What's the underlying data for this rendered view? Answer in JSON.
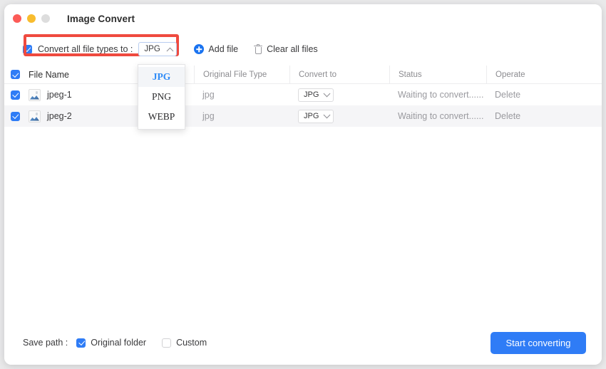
{
  "window": {
    "title": "Image Convert",
    "traffic_lights": [
      "close",
      "minimize",
      "zoom"
    ]
  },
  "toolbar": {
    "convert_all_label": "Convert all file types to :",
    "convert_all_checked": true,
    "selected_type": "JPG",
    "add_file_label": "Add file",
    "clear_all_label": "Clear all files",
    "add_file_icon": "plus-circle-icon",
    "clear_all_icon": "trash-icon",
    "annotation_color": "#ef4a3f"
  },
  "type_menu": {
    "open": true,
    "selected": "JPG",
    "options": [
      "JPG",
      "PNG",
      "WEBP"
    ]
  },
  "table": {
    "select_all_checked": true,
    "headers": {
      "file_name": "File Name",
      "original_file_type": "Original File Type",
      "convert_to": "Convert to",
      "status": "Status",
      "operate": "Operate"
    },
    "rows": [
      {
        "checked": true,
        "file_name": "jpeg-1",
        "original_file_type": "jpg",
        "convert_to": "JPG",
        "status": "Waiting to convert......",
        "operate": "Delete"
      },
      {
        "checked": true,
        "file_name": "jpeg-2",
        "original_file_type": "jpg",
        "convert_to": "JPG",
        "status": "Waiting to convert......",
        "operate": "Delete"
      }
    ]
  },
  "footer": {
    "save_path_label": "Save path :",
    "original_folder_label": "Original folder",
    "original_folder_checked": true,
    "custom_label": "Custom",
    "custom_checked": false,
    "start_button_label": "Start converting",
    "accent_color": "#2f7cf6"
  }
}
